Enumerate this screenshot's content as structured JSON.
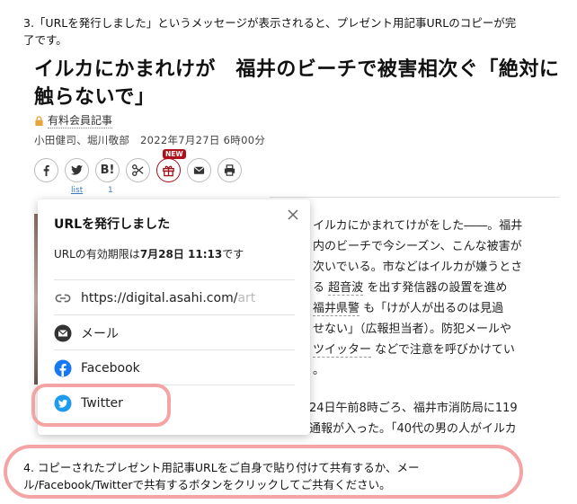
{
  "instructions": {
    "step3": "3.「URLを発行しました」というメッセージが表示されると、プレゼント用記事URLのコピーが完了です。",
    "step4": "4. コピーされたプレゼント用記事URLをご自身で貼り付けて共有するか、メール/Facebook/Twitterで共有するボタンをクリックしてご共有ください。"
  },
  "article": {
    "title": "イルカにかまれけが　福井のビーチで被害相次ぐ「絶対に触らないで」",
    "paid_label": "有料会員記事",
    "byline": "小田健司、堀川敬部　2022年7月27日 6時00分",
    "body_line1": "イルカにかまれてけがをした――。福井",
    "body_line2": "内のビーチで今シーズン、こんな被害が",
    "body_line3": "次いでいる。市などはイルカが嫌うとさ",
    "body_line4a": "る",
    "body_line4_link": "超音波",
    "body_line4b": "を出す発信器の設置を進め",
    "body_line5_link": "福井県警",
    "body_line5b": "も「けが人が出るのは見過",
    "body_line6": "せない」（広報担当者）。防犯メールや",
    "body_line7_link": "ツイッター",
    "body_line7b": "などで注意を呼びかけてい",
    "body_line8": "。",
    "body2_line1": "24日午前8時ごろ、福井市消防局に119",
    "body2_line2": "通報が入った。「40代の男の人がイルカ"
  },
  "share": {
    "new_badge": "NEW",
    "list_label": "list",
    "hatena_count": "1",
    "hatena_label": "B!"
  },
  "popup": {
    "title": "URLを発行しました",
    "expiry_prefix": "URLの有効期限は",
    "expiry_date": "7月28日 11:13",
    "expiry_suffix": "です",
    "url_visible": "https://digital.asahi.com/",
    "url_faded": "art",
    "mail_label": "メール",
    "facebook_label": "Facebook",
    "twitter_label": "Twitter"
  },
  "colors": {
    "highlight": "#f39a9a",
    "facebook": "#1877f2",
    "twitter": "#1d9bf0",
    "new_badge": "#b0101a"
  }
}
